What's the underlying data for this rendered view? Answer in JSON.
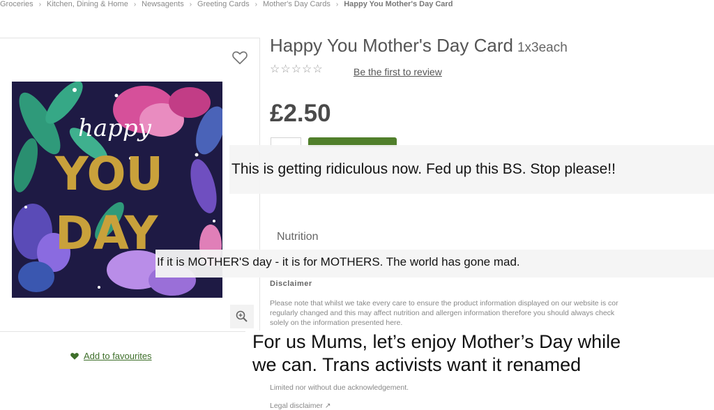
{
  "breadcrumb": {
    "items": [
      "Groceries",
      "Kitchen, Dining & Home",
      "Newsagents",
      "Greeting Cards",
      "Mother's Day Cards"
    ],
    "current": "Happy You Mother's Day Card",
    "separator": "›"
  },
  "product": {
    "title": "Happy You Mother's Day Card",
    "pack_size": "1x3each",
    "rating_stars": 0,
    "review_link": "Be the first to review",
    "price": "£2.50",
    "add_to_favourites": "Add to favourites",
    "card_art": {
      "script_word": "happy",
      "word_1": "YOU",
      "word_2": "DAY"
    }
  },
  "details": {
    "nutrition_heading": "Nutrition",
    "disclaimer_heading": "Disclaimer",
    "disclaimer_lines": [
      "Please note that whilst we take every care to ensure the product information displayed on our website is cor",
      "regularly changed and this may affect nutrition and allergen information therefore you should always check",
      "solely on the information presented here."
    ],
    "limited_text": "Limited nor without due acknowledgement.",
    "legal_link": "Legal disclaimer"
  },
  "overlays": {
    "comment_1": "This is getting ridiculous now. Fed up this BS. Stop please!!",
    "comment_2": "If it is MOTHER'S day - it is for MOTHERS. The world has gone mad.",
    "caption_line_1": "For us Mums, let’s enjoy Mother’s Day while",
    "caption_line_2": "we can. Trans activists want it renamed"
  },
  "icons": {
    "favourite": "heart-outline-icon",
    "zoom": "zoom-in-icon",
    "favourite_small": "heart-filled-icon",
    "legal": "external-link-icon"
  },
  "colors": {
    "brand_green": "#507f2b",
    "link_green": "#3e6f2a",
    "card_background": "#1e1a44",
    "card_gold": "#c9a13b"
  }
}
